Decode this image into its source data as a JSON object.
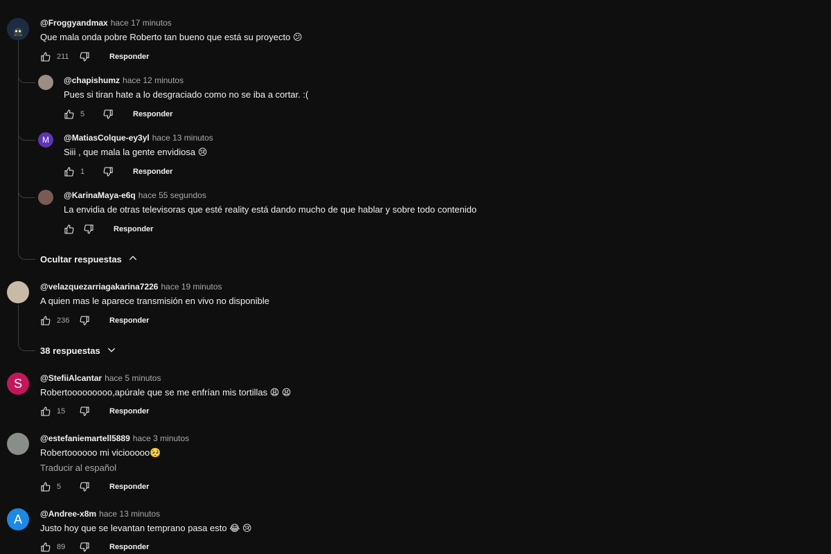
{
  "comments": [
    {
      "author": "@Froggyandmax",
      "time": "hace 17 minutos",
      "text": "Que mala onda pobre Roberto tan bueno que está su proyecto",
      "emoji": "😕",
      "likes": "211",
      "reply": "Responder",
      "avatar_color": "#2a3a55"
    },
    {
      "author": "@velazquezarriagakarina7226",
      "time": "hace 19 minutos",
      "text": "A quien mas le aparece transmisión en vivo no disponible",
      "likes": "236",
      "reply": "Responder",
      "avatar_color": "#c9b9a7"
    },
    {
      "author": "@StefiiAlcantar",
      "time": "hace 5 minutos",
      "text": "Robertooooooooo,apúrale que se me enfrían mis tortillas",
      "emoji": "😩 😫",
      "likes": "15",
      "reply": "Responder",
      "avatar_letter": "S",
      "avatar_color": "#c2185b"
    },
    {
      "author": "@estefaniemartell5889",
      "time": "hace 3 minutos",
      "text": "Robertoooooo mi viciooooo",
      "emoji": "🥺",
      "translate": "Traducir al español",
      "likes": "5",
      "reply": "Responder",
      "avatar_color": "#8a8e88"
    },
    {
      "author": "@Andree-x8m",
      "time": "hace 13 minutos",
      "text": "Justo hoy que se levantan temprano pasa esto",
      "emoji": "😂 😢",
      "likes": "89",
      "reply": "Responder",
      "avatar_letter": "A",
      "avatar_color": "#1e88e5"
    }
  ],
  "replies": [
    {
      "author": "@chapishumz",
      "time": "hace 12 minutos",
      "text": "Pues si tiran hate a lo desgraciado como no se iba a cortar. :(",
      "likes": "5",
      "reply": "Responder",
      "avatar_color": "#9b8c84"
    },
    {
      "author": "@MatiasColque-ey3yl",
      "time": "hace 13 minutos",
      "text": "Siii , que mala la gente envidiosa",
      "emoji": "😢",
      "likes": "1",
      "reply": "Responder",
      "avatar_letter": "M",
      "avatar_color": "#5e35b1"
    },
    {
      "author": "@KarinaMaya-e6q",
      "time": "hace 55 segundos",
      "text": "La envidia de otras televisoras que esté reality está dando mucho de que hablar y sobre todo contenido",
      "likes": "",
      "reply": "Responder",
      "avatar_color": "#7a5a55"
    }
  ],
  "toggles": {
    "hide_replies": "Ocultar respuestas",
    "show_replies": "38 respuestas"
  },
  "icons": {
    "like": "thumbs-up-icon",
    "dislike": "thumbs-down-icon",
    "chevron_up": "chevron-up-icon",
    "chevron_down": "chevron-down-icon"
  }
}
